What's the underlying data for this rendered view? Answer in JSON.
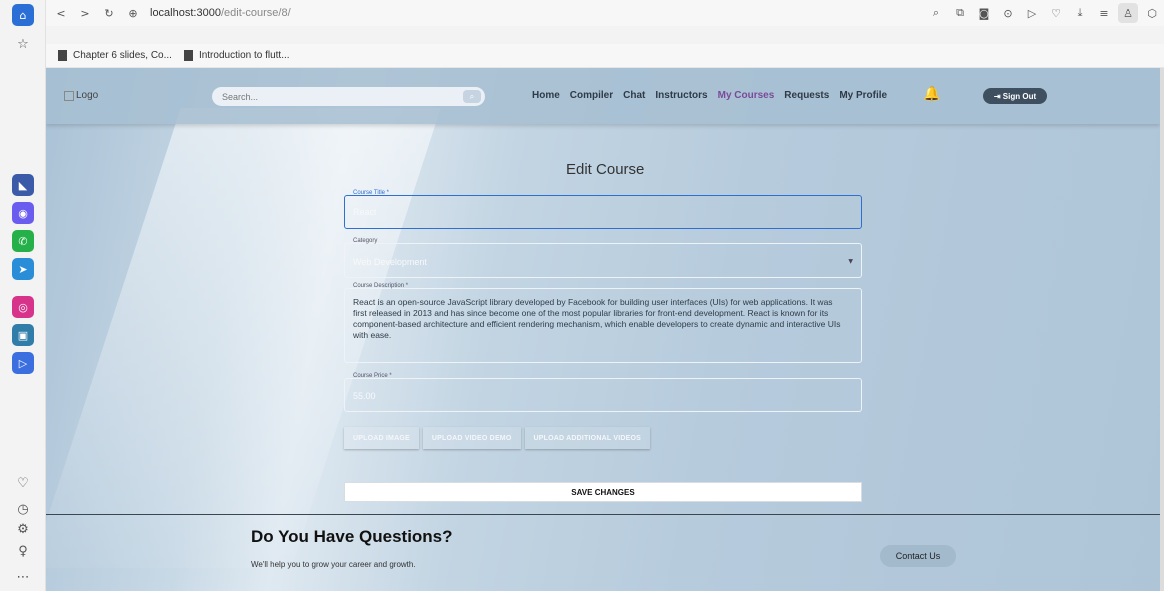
{
  "browser": {
    "url_host": "localhost:3000",
    "url_path": "/edit-course/8/",
    "bookmarks": [
      "Chapter 6 slides, Co...",
      "Introduction to flutt..."
    ]
  },
  "header": {
    "logo_alt": "Logo",
    "search_placeholder": "Search...",
    "nav": [
      "Home",
      "Compiler",
      "Chat",
      "Instructors",
      "My Courses",
      "Requests",
      "My Profile"
    ],
    "active_nav": "My Courses",
    "signout_label": "⇥ Sign Out"
  },
  "form": {
    "title": "Edit Course",
    "course_title_label": "Course Title *",
    "course_title_value": "React",
    "category_label": "Category",
    "category_value": "Web Development",
    "description_label": "Course Description *",
    "description_value": "React is an open-source JavaScript library developed by Facebook for building user interfaces (UIs) for web applications. It was first released in 2013 and has since become one of the most popular libraries for front-end development. React is known for its component-based architecture and efficient rendering mechanism, which enable developers to create dynamic and interactive UIs with ease.",
    "price_label": "Course Price *",
    "price_value": "55.00",
    "buttons": [
      "UPLOAD IMAGE",
      "UPLOAD VIDEO DEMO",
      "UPLOAD ADDITIONAL VIDEOS"
    ],
    "save_label": "SAVE CHANGES"
  },
  "footer": {
    "title": "Do You Have Questions?",
    "subtitle": "We'll help you to grow your career and growth.",
    "contact_label": "Contact Us"
  }
}
